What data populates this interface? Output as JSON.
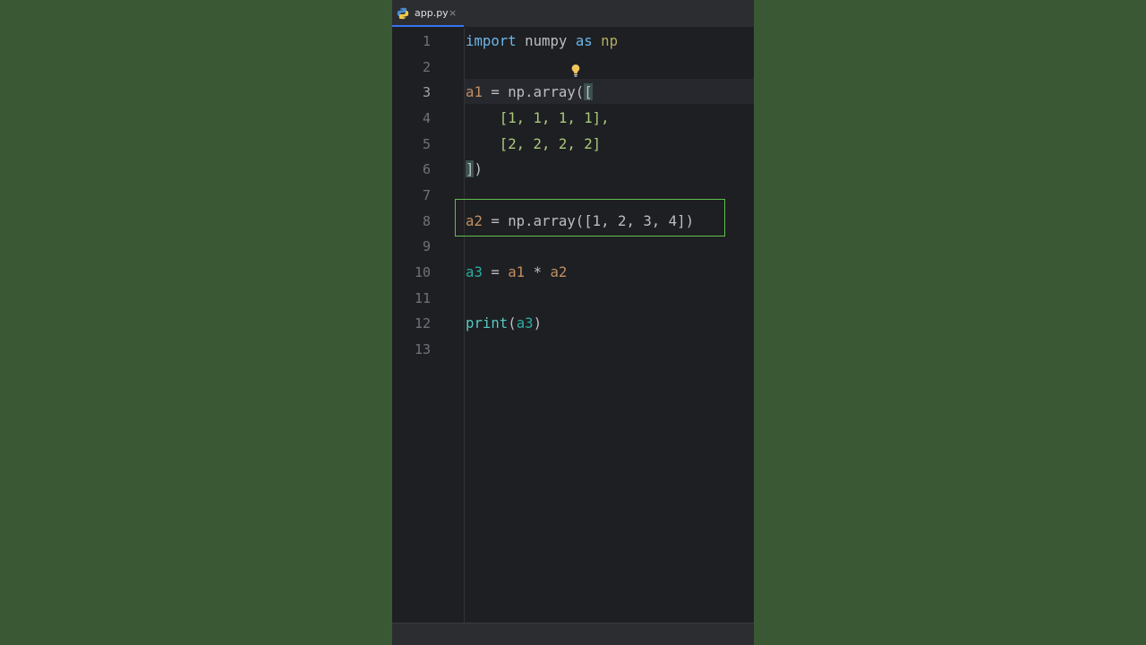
{
  "tab": {
    "icon": "python-icon",
    "label": "app.py",
    "close_label": "×"
  },
  "line_numbers": [
    "1",
    "2",
    "3",
    "4",
    "5",
    "6",
    "7",
    "8",
    "9",
    "10",
    "11",
    "12",
    "13"
  ],
  "current_line": 3,
  "code": {
    "line1": {
      "kw": "import",
      "module": "numpy",
      "as": "as",
      "alias": "np"
    },
    "line3": {
      "var": "a1",
      "eq": " = ",
      "call": "np.array(",
      "bracket": "["
    },
    "line4": {
      "text": "    [1, 1, 1, 1],"
    },
    "line5": {
      "text": "    [2, 2, 2, 2]"
    },
    "line6": {
      "bracket": "]",
      "rest": ")"
    },
    "line8": {
      "var": "a2",
      "eq": " = ",
      "call": "np.array([1, 2, 3, 4])"
    },
    "line10": {
      "var": "a3",
      "eq": " = ",
      "a1": "a1",
      "op": " * ",
      "a2": "a2"
    },
    "line12": {
      "fn": "print",
      "open": "(",
      "arg": "a3",
      "close": ")"
    }
  },
  "icons": {
    "intention_bulb": "lightbulb-icon"
  },
  "colors": {
    "highlight_box": "#5fbf4f",
    "background": "#3b5834",
    "editor_bg": "#1e1f22"
  }
}
